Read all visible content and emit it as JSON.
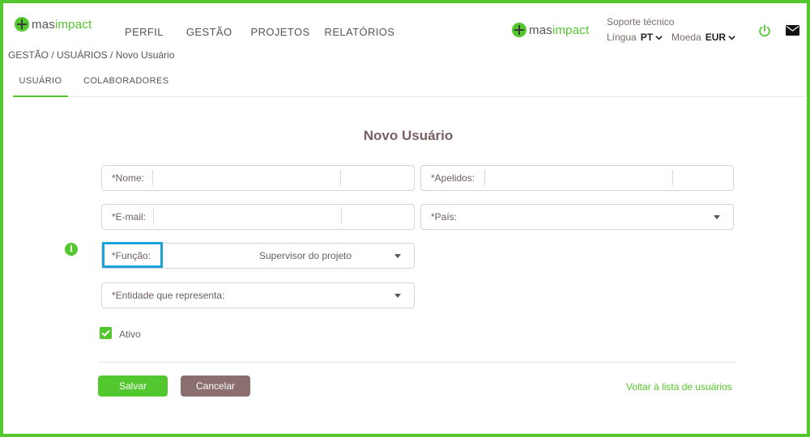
{
  "brand": {
    "name_prefix": "mas",
    "name_suffix": "impact",
    "color": "#52c72e"
  },
  "nav": {
    "items": [
      "PERFIL",
      "GESTÃO",
      "PROJETOS",
      "RELATÓRIOS"
    ]
  },
  "header": {
    "support": "Soporte técnico",
    "language_label": "Língua",
    "language_value": "PT",
    "currency_label": "Moeda",
    "currency_value": "EUR"
  },
  "breadcrumb": "GESTÃO / USUÁRIOS / Novo Usuário",
  "tabs": [
    "USUÁRIO",
    "COLABORADORES"
  ],
  "form": {
    "title": "Novo Usuário",
    "nome_label": "*Nome:",
    "apelidos_label": "*Apelidos:",
    "email_label": "*E-mail:",
    "pais_label": "*País:",
    "funcao_label": "*Função:",
    "funcao_value": "Supervisor do projeto",
    "entidade_label": "*Entidade que representa:",
    "ativo_label": "Ativo",
    "ativo_checked": true
  },
  "actions": {
    "save": "Salvar",
    "cancel": "Cancelar",
    "back": "Voltar à lista de usuários"
  },
  "colors": {
    "accent": "#52c72e",
    "cancel": "#8b6f6f",
    "highlight": "#1aa3db",
    "title": "#7a6060"
  }
}
